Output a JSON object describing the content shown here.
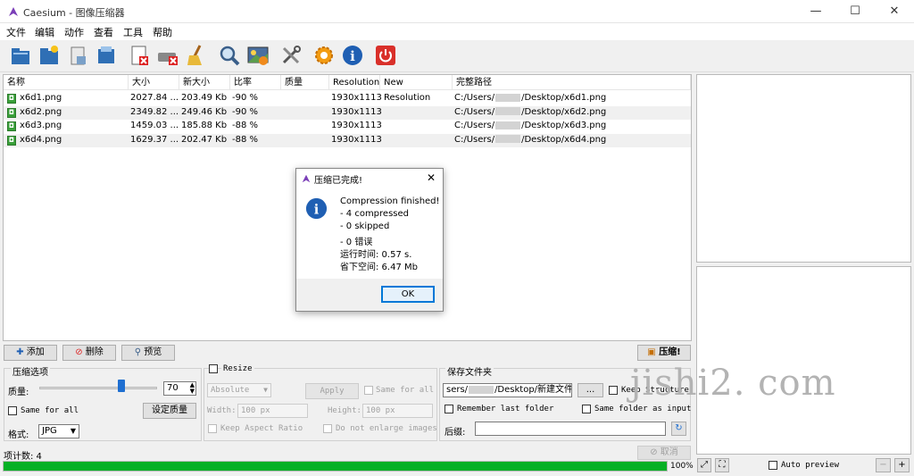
{
  "window": {
    "title": "Caesium - 图像压缩器",
    "minimize": "—",
    "maximize": "☐",
    "close": "✕"
  },
  "menu": [
    "文件",
    "编辑",
    "动作",
    "查看",
    "工具",
    "帮助"
  ],
  "toolbar_icons": [
    "open-file-icon",
    "open-folder-icon",
    "save-list-icon",
    "save-all-icon",
    "remove-item-icon",
    "remove-all-icon",
    "clear-list-icon",
    "preview-icon",
    "image-preview-icon",
    "tools-icon",
    "settings-icon",
    "info-icon",
    "exit-icon"
  ],
  "list": {
    "columns": [
      "名称",
      "大小",
      "新大小",
      "比率",
      "质量",
      "Resolution",
      "New Resolution",
      "完整路径"
    ],
    "rows": [
      {
        "name": "x6d1.png",
        "size": "2027.84 ...",
        "new_size": "203.49 Kb",
        "ratio": "-90 %",
        "quality": "",
        "resolution": "1930x1113",
        "new_resolution": "",
        "path_prefix": "C:/Users/",
        "path_suffix": "/Desktop/x6d1.png"
      },
      {
        "name": "x6d2.png",
        "size": "2349.82 ...",
        "new_size": "249.46 Kb",
        "ratio": "-90 %",
        "quality": "",
        "resolution": "1930x1113",
        "new_resolution": "",
        "path_prefix": "C:/Users/",
        "path_suffix": "/Desktop/x6d2.png"
      },
      {
        "name": "x6d3.png",
        "size": "1459.03 ...",
        "new_size": "185.88 Kb",
        "ratio": "-88 %",
        "quality": "",
        "resolution": "1930x1113",
        "new_resolution": "",
        "path_prefix": "C:/Users/",
        "path_suffix": "/Desktop/x6d3.png"
      },
      {
        "name": "x6d4.png",
        "size": "1629.37 ...",
        "new_size": "202.47 Kb",
        "ratio": "-88 %",
        "quality": "",
        "resolution": "1930x1113",
        "new_resolution": "",
        "path_prefix": "C:/Users/",
        "path_suffix": "/Desktop/x6d4.png"
      }
    ]
  },
  "actions": {
    "add": "添加",
    "remove": "删除",
    "preview": "预览",
    "compress": "压缩!"
  },
  "compression": {
    "group_title": "压缩选项",
    "quality_label": "质量:",
    "quality_value": "70",
    "quality_fraction": 0.7,
    "same_for_all": "Same for all",
    "set_quality": "设定质量",
    "format_label": "格式:",
    "format_value": "JPG"
  },
  "resize": {
    "title": "Resize",
    "mode": "Absolute",
    "apply": "Apply",
    "same_for_all": "Same for all",
    "width_label": "Width:",
    "width_value": "100 px",
    "height_label": "Height:",
    "height_value": "100 px",
    "keep_aspect": "Keep Aspect Ratio",
    "no_enlarge": "Do not enlarge images"
  },
  "output": {
    "group_title": "保存文件夹",
    "folder_prefix": "sers/",
    "folder_suffix": "/Desktop/新建文件夹",
    "browse": "...",
    "keep_structure": "Keep Structure",
    "remember_last": "Remember last folder",
    "same_as_input": "Same folder as input",
    "suffix_label": "后缀:",
    "suffix_value": ""
  },
  "status": {
    "item_count": "项计数: 4",
    "cancel": "取消",
    "progress_text": "100%",
    "progress_fraction": 1.0
  },
  "preview": {
    "auto_preview": "Auto preview",
    "zoom_out": "−",
    "zoom_in": "+"
  },
  "dialog": {
    "title": "压缩已完成!",
    "close": "✕",
    "lines": [
      "Compression finished!",
      "- 4 compressed",
      "- 0 skipped",
      "- 0 错误",
      "运行时间: 0.57 s.",
      "省下空间: 6.47 Mb"
    ],
    "ok": "OK"
  },
  "watermark": "jishi2. com",
  "colors": {
    "progress": "#06b025",
    "accent": "#0078d7",
    "info": "#1f5fb3"
  }
}
